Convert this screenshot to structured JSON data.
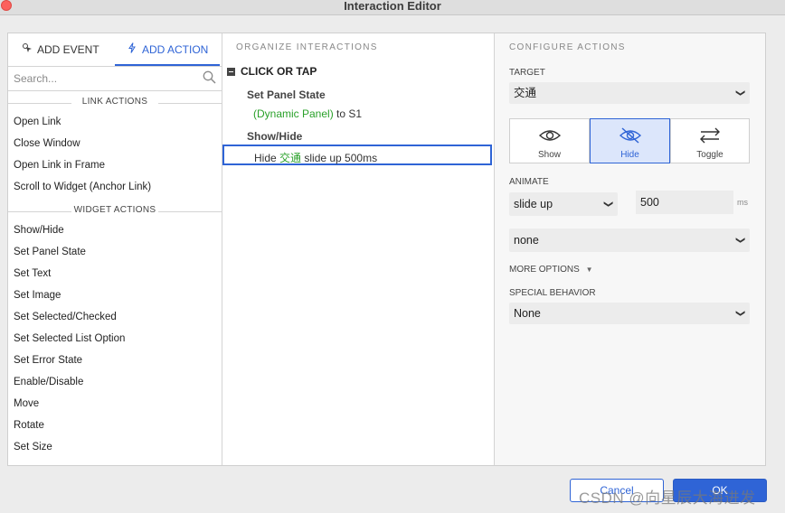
{
  "window": {
    "title": "Interaction Editor"
  },
  "tabs": {
    "add_event": "ADD EVENT",
    "add_action": "ADD ACTION"
  },
  "search": {
    "placeholder": "Search..."
  },
  "link_actions": {
    "heading": "LINK ACTIONS",
    "items": [
      "Open Link",
      "Close Window",
      "Open Link in Frame",
      "Scroll to Widget (Anchor Link)"
    ]
  },
  "widget_actions": {
    "heading": "WIDGET ACTIONS",
    "items": [
      "Show/Hide",
      "Set Panel State",
      "Set Text",
      "Set Image",
      "Set Selected/Checked",
      "Set Selected List Option",
      "Set Error State",
      "Enable/Disable",
      "Move",
      "Rotate",
      "Set Size"
    ]
  },
  "organize": {
    "heading": "ORGANIZE INTERACTIONS",
    "event": "CLICK OR TAP",
    "actions": [
      {
        "title": "Set Panel State",
        "target": "(Dynamic Panel)",
        "rest": " to S1"
      },
      {
        "title": "Show/Hide",
        "verb": "Hide ",
        "target": "交通",
        "rest": " slide up 500ms"
      }
    ]
  },
  "configure": {
    "heading": "CONFIGURE ACTIONS",
    "target_label": "TARGET",
    "target_value": "交通",
    "visibility": {
      "show": "Show",
      "hide": "Hide",
      "toggle": "Toggle",
      "selected": "Hide"
    },
    "animate_label": "ANIMATE",
    "animate_value": "slide up",
    "duration_value": "500",
    "duration_unit": "ms",
    "easing_value": "none",
    "more_options": "MORE OPTIONS",
    "special_label": "SPECIAL BEHAVIOR",
    "special_value": "None"
  },
  "footer": {
    "cancel": "Cancel",
    "ok": "OK"
  },
  "watermark": "CSDN @向星辰大海进发",
  "colors": {
    "accent": "#2f64d6",
    "target_green": "#2aa12a"
  }
}
